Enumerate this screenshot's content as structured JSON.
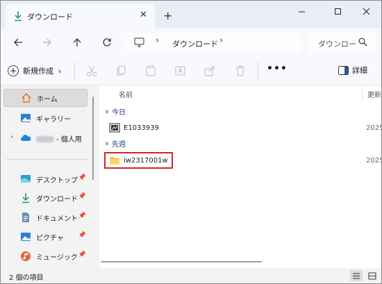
{
  "tab": {
    "title": "ダウンロード"
  },
  "breadcrumb": {
    "items": [
      "ダウンロード"
    ]
  },
  "search": {
    "placeholder": "ダウンロー"
  },
  "toolbar": {
    "new_label": "新規作成",
    "details_label": "詳細",
    "more_label": "•••"
  },
  "sidebar": {
    "items": [
      {
        "label": "ホーム",
        "icon": "home-icon"
      },
      {
        "label": "ギャラリー",
        "icon": "gallery-icon"
      },
      {
        "label": "- 個人用",
        "icon": "cloud-icon"
      },
      {
        "label": "デスクトップ",
        "icon": "desktop-icon"
      },
      {
        "label": "ダウンロード",
        "icon": "download-icon"
      },
      {
        "label": "ドキュメント",
        "icon": "documents-icon"
      },
      {
        "label": "ピクチャ",
        "icon": "pictures-icon"
      },
      {
        "label": "ミュージック",
        "icon": "music-icon"
      }
    ]
  },
  "content": {
    "column_name": "名前",
    "column_date": "更新",
    "groups": [
      {
        "label": "今日",
        "files": [
          {
            "name": "E1033939",
            "date": "2025",
            "icon": "image-file-icon"
          }
        ]
      },
      {
        "label": "先週",
        "files": [
          {
            "name": "iw2317001w",
            "date": "2025",
            "icon": "folder-icon"
          }
        ]
      }
    ]
  },
  "status": {
    "item_count": "2 個の項目"
  },
  "colors": {
    "accent": "#0067c0",
    "highlight_border": "#d0242b",
    "folder": "#f7c844"
  }
}
